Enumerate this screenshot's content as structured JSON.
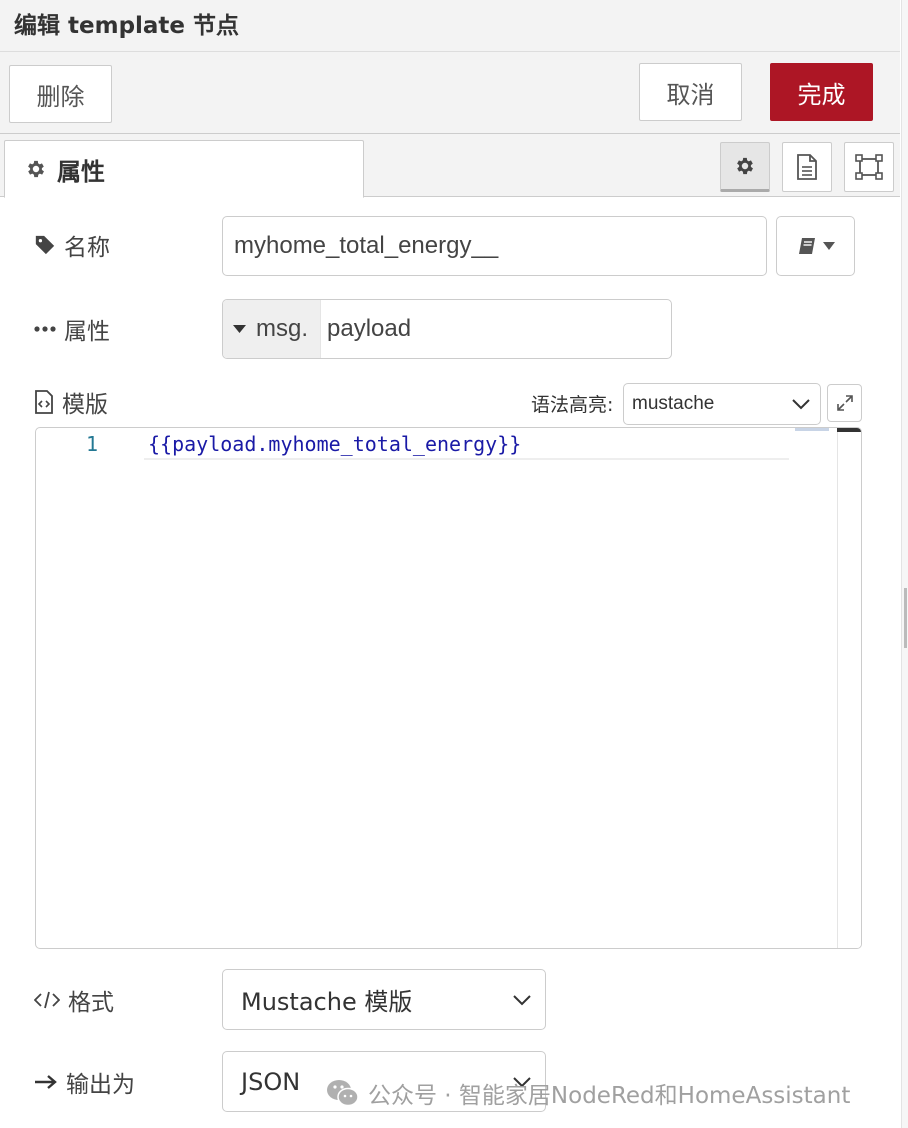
{
  "header": {
    "title": "编辑 template 节点"
  },
  "toolbar": {
    "delete_label": "删除",
    "cancel_label": "取消",
    "done_label": "完成",
    "done_color": "#ad1625"
  },
  "tabs": {
    "properties_label": "属性",
    "icons": [
      "gear-icon",
      "document-icon",
      "frame-icon"
    ]
  },
  "form": {
    "name": {
      "label": "名称",
      "value": "myhome_total_energy__"
    },
    "property": {
      "label": "属性",
      "prefix": "msg.",
      "value": "payload"
    },
    "template": {
      "label": "模版",
      "syntax_label": "语法高亮:",
      "syntax_value": "mustache",
      "line_number": "1",
      "code": "{{payload.myhome_total_energy}}"
    },
    "format": {
      "label": "格式",
      "value": "Mustache 模版"
    },
    "output": {
      "label": "输出为",
      "value": "JSON"
    }
  },
  "watermark": {
    "text": "公众号 · 智能家居NodeRed和HomeAssistant"
  }
}
